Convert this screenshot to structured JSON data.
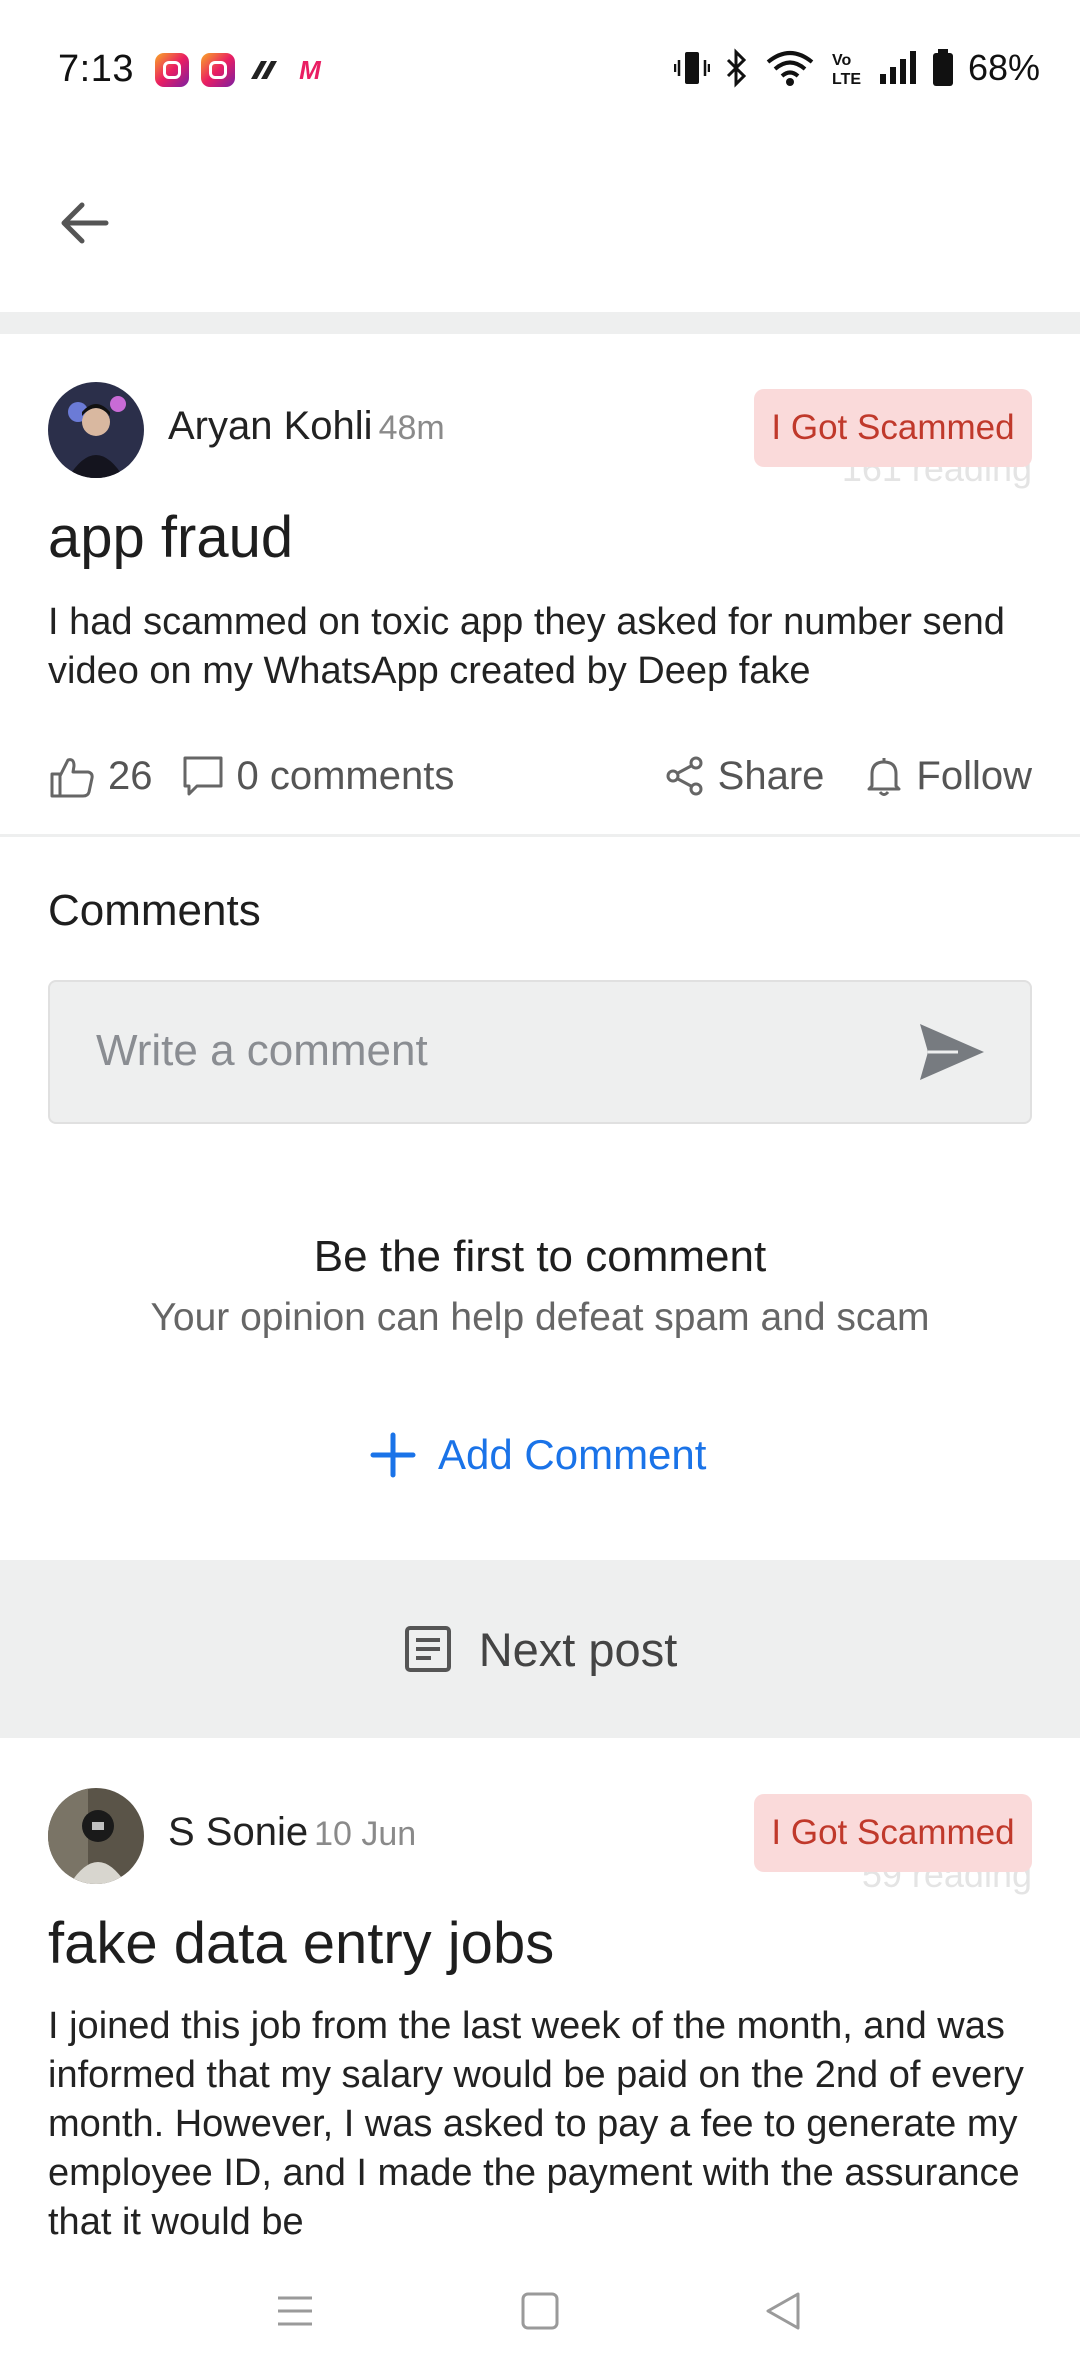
{
  "status": {
    "time": "7:13",
    "battery": "68%"
  },
  "post1": {
    "author": "Aryan Kohli",
    "time": "48m",
    "tag": "I Got Scammed",
    "reading": "161 reading",
    "title": "app fraud",
    "body": "I had scammed on toxic app they asked for number send video on my WhatsApp created by Deep fake",
    "likes": "26",
    "comments_label": "0 comments",
    "share_label": "Share",
    "follow_label": "Follow"
  },
  "comments": {
    "heading": "Comments",
    "placeholder": "Write a comment",
    "empty_title": "Be the first to comment",
    "empty_subtitle": "Your opinion can help defeat spam and scam",
    "add_label": "Add Comment"
  },
  "next_post": {
    "label": "Next post"
  },
  "post2": {
    "author": "S Sonie",
    "time": "10 Jun",
    "tag": "I Got Scammed",
    "reading": "59 reading",
    "title": "fake data entry jobs",
    "body": "I joined this job from the last week of the month, and was informed that my salary would be paid on the 2nd of every month. However, I was asked to pay a fee to generate my employee ID, and I made the payment with the assurance that it would be"
  },
  "colors": {
    "accent_blue": "#1a73e8",
    "tag_bg": "#fadada",
    "tag_text": "#c0392b",
    "band_gray": "#eeefef"
  },
  "icons": [
    "back-arrow-icon",
    "thumbs-up-icon",
    "comment-icon",
    "share-icon",
    "bell-icon",
    "send-icon",
    "plus-icon",
    "document-icon",
    "menu-icon",
    "home-icon",
    "back-triangle-icon"
  ]
}
